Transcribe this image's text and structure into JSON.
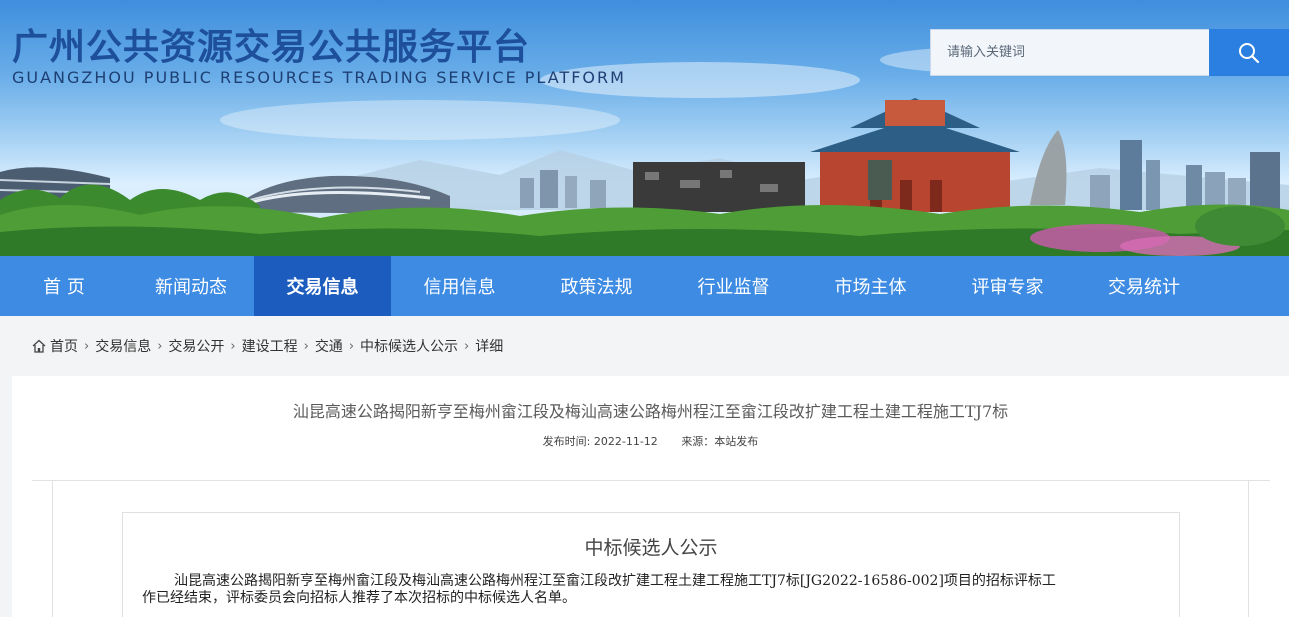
{
  "header": {
    "title": "广州公共资源交易公共服务平台",
    "subtitle": "GUANGZHOU PUBLIC RESOURCES TRADING SERVICE PLATFORM",
    "search_placeholder": "请输入关键词",
    "search_icon": "search-icon",
    "accent_color": "#2a7fe0"
  },
  "nav": {
    "items": [
      "首 页",
      "新闻动态",
      "交易信息",
      "信用信息",
      "政策法规",
      "行业监督",
      "市场主体",
      "评审专家",
      "交易统计"
    ],
    "active": "交易信息",
    "bg_color": "#3d8be3",
    "active_color": "#1d5cbf"
  },
  "breadcrumb": {
    "home_icon": "home-icon",
    "items": [
      "首页",
      "交易信息",
      "交易公开",
      "建设工程",
      "交通",
      "中标候选人公示",
      "详细"
    ]
  },
  "article": {
    "title": "汕昆高速公路揭阳新亨至梅州畲江段及梅汕高速公路梅州程江至畲江段改扩建工程土建工程施工TJ7标",
    "publish_time": "发布时间: 2022-11-12",
    "source": "来源：本站发布",
    "notice_title": "中标候选人公示",
    "body_line1": "汕昆高速公路揭阳新亨至梅州畲江段及梅汕高速公路梅州程江至畲江段改扩建工程土建工程施工TJ7标[JG2022-16586-002]项目的招标评标工",
    "body_line2": "作已经结束，评标委员会向招标人推荐了本次招标的中标候选人名单。"
  }
}
